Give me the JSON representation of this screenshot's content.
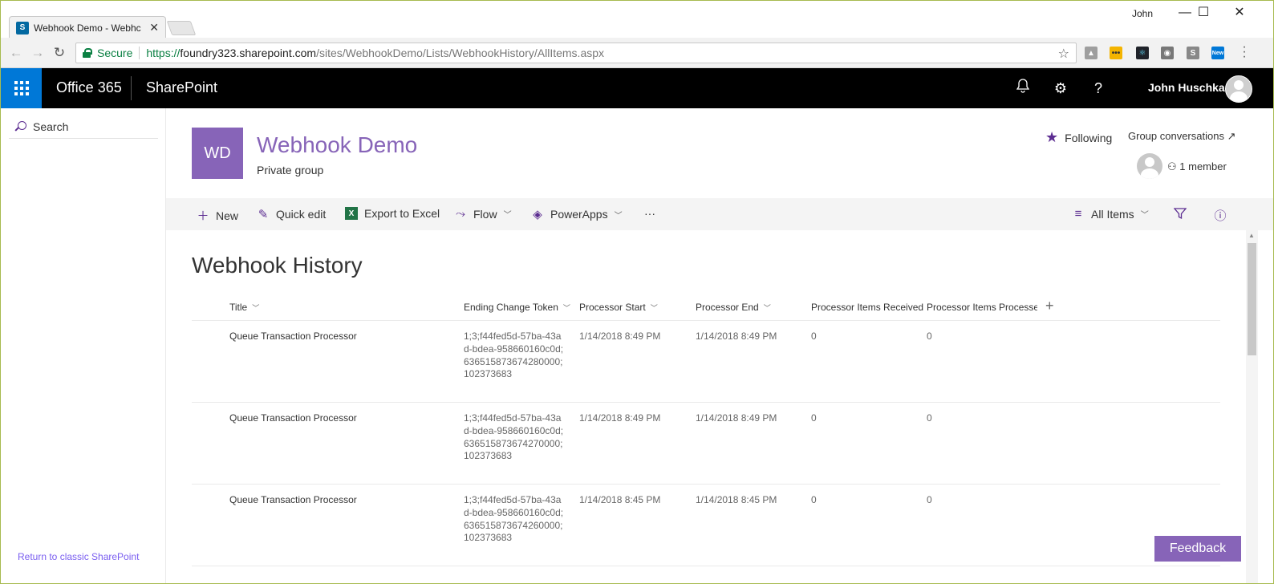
{
  "browser": {
    "tab_title": "Webhook Demo - Webhc",
    "tab_favicon": "S",
    "window_user": "John",
    "url_secure_label": "Secure",
    "url_scheme": "https://",
    "url_host": "foundry323.sharepoint.com",
    "url_path": "/sites/WebhookDemo/Lists/WebhookHistory/AllItems.aspx",
    "extensions": [
      "drive-icon",
      "keep-icon",
      "react-devtools-icon",
      "globe-icon",
      "s-icon",
      "new-badge-icon"
    ]
  },
  "suitebar": {
    "brand": "Office 365",
    "app": "SharePoint",
    "user": "John Huschka"
  },
  "leftnav": {
    "search_label": "Search",
    "classic_link": "Return to classic SharePoint"
  },
  "site": {
    "logo_initials": "WD",
    "title": "Webhook Demo",
    "subtitle": "Private group",
    "following": "Following",
    "group_conversations": "Group conversations",
    "members": "1 member"
  },
  "commands": {
    "new": "New",
    "quick_edit": "Quick edit",
    "export": "Export to Excel",
    "flow": "Flow",
    "powerapps": "PowerApps",
    "more": "···",
    "view": "All Items"
  },
  "list": {
    "title": "Webhook History",
    "columns": [
      "Title",
      "Ending Change Token",
      "Processor Start",
      "Processor End",
      "Processor Items Received",
      "Processor Items Processec"
    ],
    "rows": [
      {
        "title": "Queue Transaction Processor",
        "token": "1;3;f44fed5d-57ba-43ad-bdea-958660160c0d;636515873674280000;102373683",
        "start": "1/14/2018 8:49 PM",
        "end": "1/14/2018 8:49 PM",
        "received": "0",
        "processed": "0"
      },
      {
        "title": "Queue Transaction Processor",
        "token": "1;3;f44fed5d-57ba-43ad-bdea-958660160c0d;636515873674270000;102373683",
        "start": "1/14/2018 8:49 PM",
        "end": "1/14/2018 8:49 PM",
        "received": "0",
        "processed": "0"
      },
      {
        "title": "Queue Transaction Processor",
        "token": "1;3;f44fed5d-57ba-43ad-bdea-958660160c0d;636515873674260000;102373683",
        "start": "1/14/2018 8:45 PM",
        "end": "1/14/2018 8:45 PM",
        "received": "0",
        "processed": "0"
      }
    ]
  },
  "feedback": "Feedback",
  "colors": {
    "accent": "#8764b8",
    "suitebar": "#000000",
    "waffle": "#0078d7",
    "link": "#7a5ef0"
  }
}
